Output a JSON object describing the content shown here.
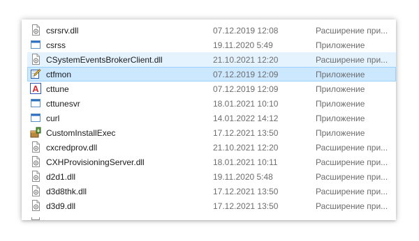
{
  "files": [
    {
      "name": "csrsrv.dll",
      "date": "07.12.2019 12:08",
      "type": "Расширение при...",
      "icon": "dll-file-icon"
    },
    {
      "name": "csrss",
      "date": "19.11.2020 5:49",
      "type": "Приложение",
      "icon": "app-window-icon"
    },
    {
      "name": "CSystemEventsBrokerClient.dll",
      "date": "21.10.2021 12:20",
      "type": "Расширение при...",
      "icon": "dll-file-icon"
    },
    {
      "name": "ctfmon",
      "date": "07.12.2019 12:09",
      "type": "Приложение",
      "icon": "ctfmon-pen-icon"
    },
    {
      "name": "cttune",
      "date": "07.12.2019 12:09",
      "type": "Приложение",
      "icon": "cleartype-icon"
    },
    {
      "name": "cttunesvr",
      "date": "18.01.2021 10:10",
      "type": "Приложение",
      "icon": "app-window-icon"
    },
    {
      "name": "curl",
      "date": "14.01.2022 14:12",
      "type": "Приложение",
      "icon": "app-window-icon"
    },
    {
      "name": "CustomInstallExec",
      "date": "17.12.2021 13:50",
      "type": "Приложение",
      "icon": "installer-icon"
    },
    {
      "name": "cxcredprov.dll",
      "date": "21.10.2021 12:20",
      "type": "Расширение при...",
      "icon": "dll-file-icon"
    },
    {
      "name": "CXHProvisioningServer.dll",
      "date": "18.01.2021 10:11",
      "type": "Расширение при...",
      "icon": "dll-file-icon"
    },
    {
      "name": "d2d1.dll",
      "date": "19.11.2020 5:48",
      "type": "Расширение при...",
      "icon": "dll-file-icon"
    },
    {
      "name": "d3d8thk.dll",
      "date": "17.12.2021 13:50",
      "type": "Расширение при...",
      "icon": "dll-file-icon"
    },
    {
      "name": "d3d9.dll",
      "date": "17.12.2021 13:50",
      "type": "Расширение при...",
      "icon": "dll-file-icon"
    }
  ],
  "hover_row_index": 2,
  "selected_row_index": 3,
  "colors": {
    "hover_bg": "#e5f3ff",
    "selected_bg": "#cce8ff",
    "selected_border": "#99d1ff",
    "secondary_text": "#6d6d6d"
  }
}
